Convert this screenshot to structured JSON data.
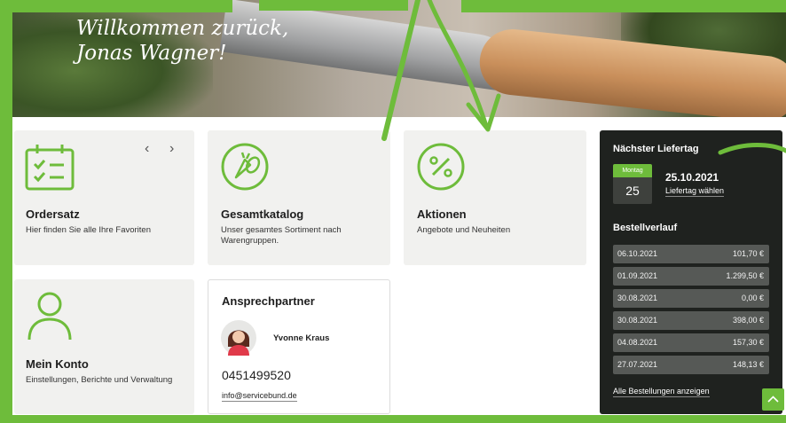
{
  "hero": {
    "greeting_line1": "Willkommen zurück,",
    "greeting_line2": "Jonas Wagner!"
  },
  "cards": {
    "ordersatz": {
      "title": "Ordersatz",
      "subtitle": "Hier finden Sie alle Ihre Favoriten",
      "icon": "checklist-icon",
      "prev": "‹",
      "next": "›"
    },
    "gesamtkatalog": {
      "title": "Gesamtkatalog",
      "subtitle_line1": "Unser gesamtes Sortiment nach",
      "subtitle_line2": "Warengruppen.",
      "icon": "vegetables-icon"
    },
    "aktionen": {
      "title": "Aktionen",
      "subtitle": "Angebote und Neuheiten",
      "icon": "percent-icon"
    },
    "konto": {
      "title": "Mein Konto",
      "subtitle": "Einstellungen, Berichte und Verwaltung",
      "icon": "user-icon"
    }
  },
  "contact": {
    "title": "Ansprechpartner",
    "name": "Yvonne Kraus",
    "phone": "0451499520",
    "email": "info@servicebund.de"
  },
  "panel": {
    "delivery_title": "Nächster Liefertag",
    "month_label": "Montag",
    "day": "25",
    "date": "25.10.2021",
    "choose_link": "Liefertag wählen",
    "history_title": "Bestellverlauf",
    "orders": [
      {
        "date": "06.10.2021",
        "amount": "101,70 €"
      },
      {
        "date": "01.09.2021",
        "amount": "1.299,50 €"
      },
      {
        "date": "30.08.2021",
        "amount": "0,00 €"
      },
      {
        "date": "30.08.2021",
        "amount": "398,00 €"
      },
      {
        "date": "04.08.2021",
        "amount": "157,30 €"
      },
      {
        "date": "27.07.2021",
        "amount": "148,13 €"
      }
    ],
    "all_orders_link": "Alle Bestellungen anzeigen"
  },
  "scroll_top": "^",
  "colors": {
    "accent": "#6ebc3b",
    "panel_bg": "#1f221f",
    "card_bg": "#f1f1ef"
  }
}
